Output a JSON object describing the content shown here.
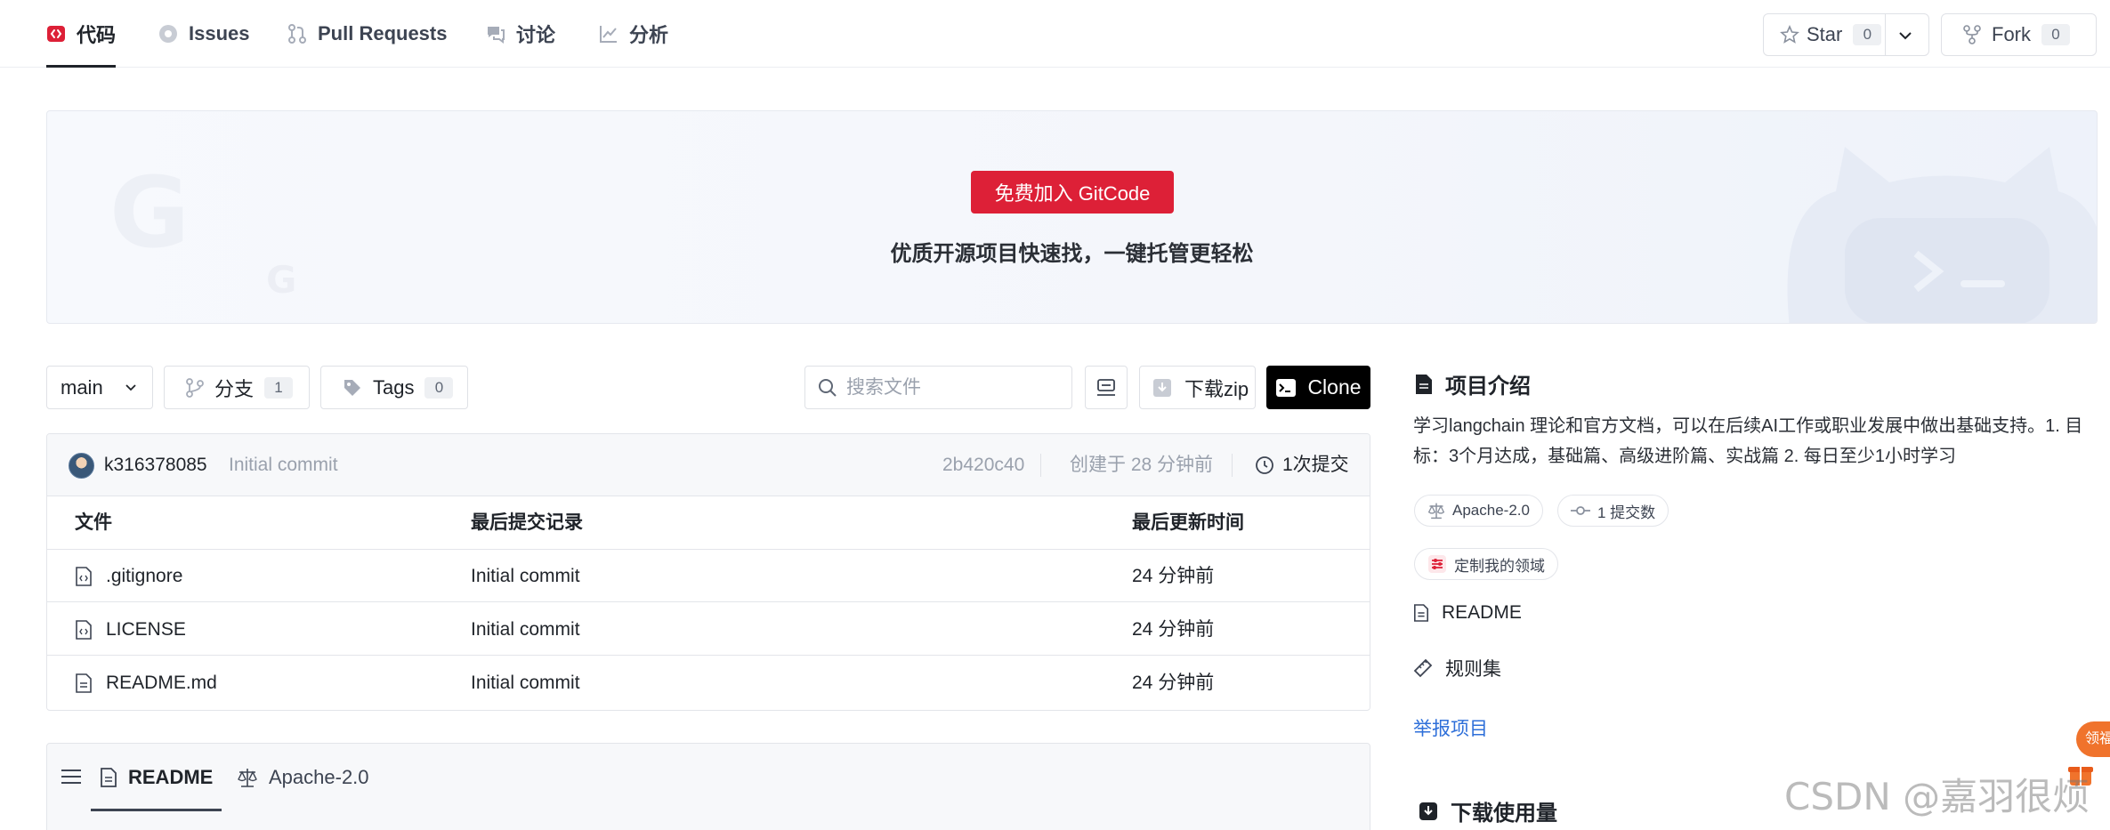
{
  "nav": {
    "tabs": [
      {
        "label": "代码",
        "icon": "code-icon"
      },
      {
        "label": "Issues",
        "icon": "issue-icon"
      },
      {
        "label": "Pull Requests",
        "icon": "pull-request-icon"
      },
      {
        "label": "讨论",
        "icon": "discussion-icon"
      },
      {
        "label": "分析",
        "icon": "analytics-icon"
      }
    ],
    "star_label": "Star",
    "star_count": "0",
    "fork_label": "Fork",
    "fork_count": "0"
  },
  "banner": {
    "join_label": "免费加入 GitCode",
    "tagline": "优质开源项目快速找，一键托管更轻松"
  },
  "toolbar": {
    "branch": "main",
    "branches_label": "分支",
    "branches_count": "1",
    "tags_label": "Tags",
    "tags_count": "0",
    "search_placeholder": "搜索文件",
    "download_label": "下载zip",
    "clone_label": "Clone"
  },
  "commit": {
    "author": "k316378085",
    "message": "Initial commit",
    "hash": "2b420c40",
    "created": "创建于 28 分钟前",
    "commits": "1次提交"
  },
  "files": {
    "headers": [
      "文件",
      "最后提交记录",
      "最后更新时间"
    ],
    "rows": [
      {
        "name": ".gitignore",
        "commit": "Initial commit",
        "time": "24 分钟前",
        "icon": "code-file-icon"
      },
      {
        "name": "LICENSE",
        "commit": "Initial commit",
        "time": "24 分钟前",
        "icon": "code-file-icon"
      },
      {
        "name": "README.md",
        "commit": "Initial commit",
        "time": "24 分钟前",
        "icon": "document-file-icon"
      }
    ]
  },
  "readme_tabs": {
    "readme": "README",
    "license": "Apache-2.0"
  },
  "sidebar": {
    "intro_title": "项目介绍",
    "description": "学习langchain 理论和官方文档，可以在后续AI工作或职业发展中做出基础支持。1. 目标：3个月达成，基础篇、高级进阶篇、实战篇 2. 每日至少1小时学习",
    "license_chip": "Apache-2.0",
    "commits_chip": "1 提交数",
    "customize_chip": "定制我的领域",
    "readme_link": "README",
    "rules_link": "规则集",
    "report_link": "举报项目",
    "downloads_title": "下载使用量"
  },
  "overlay": {
    "watermark": "CSDN @嘉羽很烦",
    "float_badge": "领福"
  },
  "colors": {
    "accent_red": "#dd2037",
    "link_blue": "#2e6fd9",
    "clone_black": "#000000"
  }
}
